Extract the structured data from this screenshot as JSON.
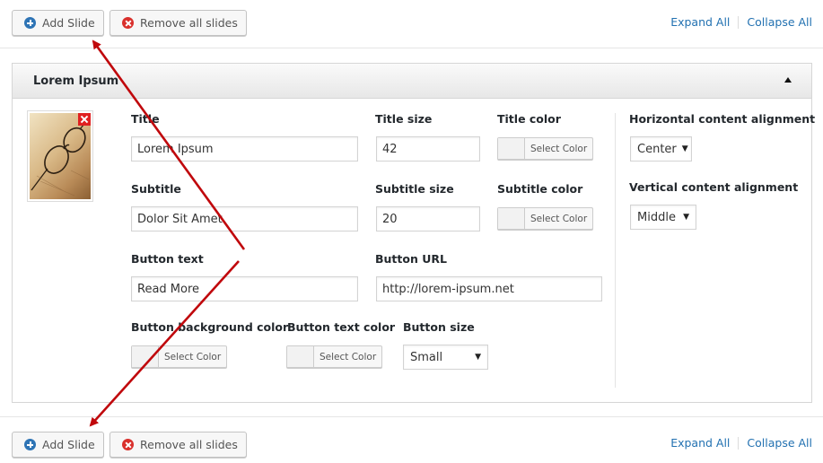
{
  "toolbar_top": {
    "add_label": "Add Slide",
    "remove_label": "Remove all slides",
    "expand_label": "Expand All",
    "collapse_label": "Collapse All"
  },
  "toolbar_bottom": {
    "add_label": "Add Slide",
    "remove_label": "Remove all slides",
    "expand_label": "Expand All",
    "collapse_label": "Collapse All"
  },
  "slide": {
    "header_title": "Lorem Ipsum",
    "title_label": "Title",
    "title_value": "Lorem Ipsum",
    "title_size_label": "Title size",
    "title_size_value": "42",
    "title_color_label": "Title color",
    "subtitle_label": "Subtitle",
    "subtitle_value": "Dolor Sit Amet",
    "subtitle_size_label": "Subtitle size",
    "subtitle_size_value": "20",
    "subtitle_color_label": "Subtitle color",
    "button_text_label": "Button text",
    "button_text_value": "Read More",
    "button_url_label": "Button URL",
    "button_url_value": "http://lorem-ipsum.net",
    "button_bg_color_label": "Button background color",
    "button_text_color_label": "Button text color",
    "button_size_label": "Button size",
    "button_size_value": "Small",
    "select_color_label": "Select Color",
    "h_align_label": "Horizontal content alignment",
    "h_align_value": "Center",
    "v_align_label": "Vertical content alignment",
    "v_align_value": "Middle"
  },
  "icons": {
    "add": "plus-circle-icon",
    "remove": "times-circle-icon",
    "toggle": "caret-up-icon",
    "remove_image": "close-icon"
  },
  "colors": {
    "accent_link": "#2271b1",
    "add_icon": "#2e74b5",
    "remove_icon": "#d9302c",
    "arrow": "#c0080c"
  }
}
